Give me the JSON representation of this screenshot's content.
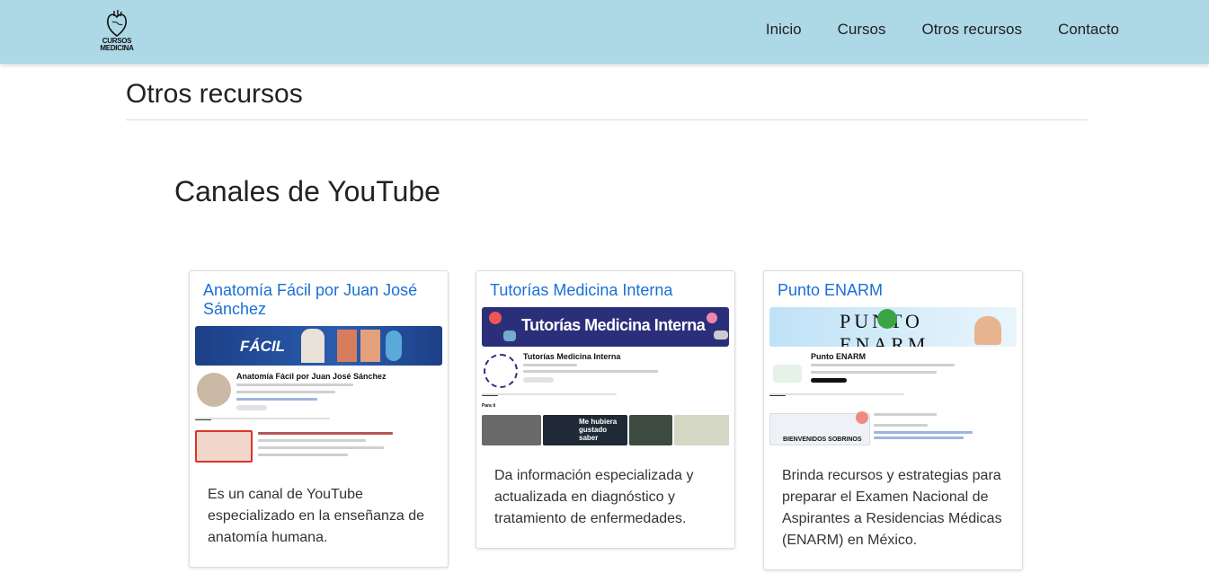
{
  "header": {
    "logo_text_line1": "CURSOS",
    "logo_text_line2": "MEDICINA",
    "nav": [
      "Inicio",
      "Cursos",
      "Otros recursos",
      "Contacto"
    ]
  },
  "page": {
    "title": "Otros recursos",
    "section_title": "Canales de YouTube"
  },
  "cards": [
    {
      "title": "Anatomía Fácil por Juan José Sánchez",
      "description": "Es un canal de YouTube especializado en la enseñanza de anatomía humana.",
      "banner_text": "FÁCIL",
      "channel_name": "Anatomía Fácil por Juan José Sánchez"
    },
    {
      "title": "Tutorías Medicina Interna",
      "description": "Da información especializada y actualizada en diagnóstico y tratamiento de enfermedades.",
      "banner_text": "Tutorías Medicina Interna",
      "channel_name": "Tutorías Medicina Interna",
      "section_label": "Para ti",
      "video_caption": "Me hubiera gustado saber"
    },
    {
      "title": "Punto ENARM",
      "description": "Brinda recursos y estrategias para preparar el Examen Nacional de Aspirantes a Residencias Médicas (ENARM) en México.",
      "banner_text": "PUNTO ENARM",
      "channel_name": "Punto ENARM",
      "video_caption": "BIENVENIDOS SOBRINOS"
    }
  ],
  "colors": {
    "navbar": "#add8e6",
    "link": "#1a6fd6"
  }
}
